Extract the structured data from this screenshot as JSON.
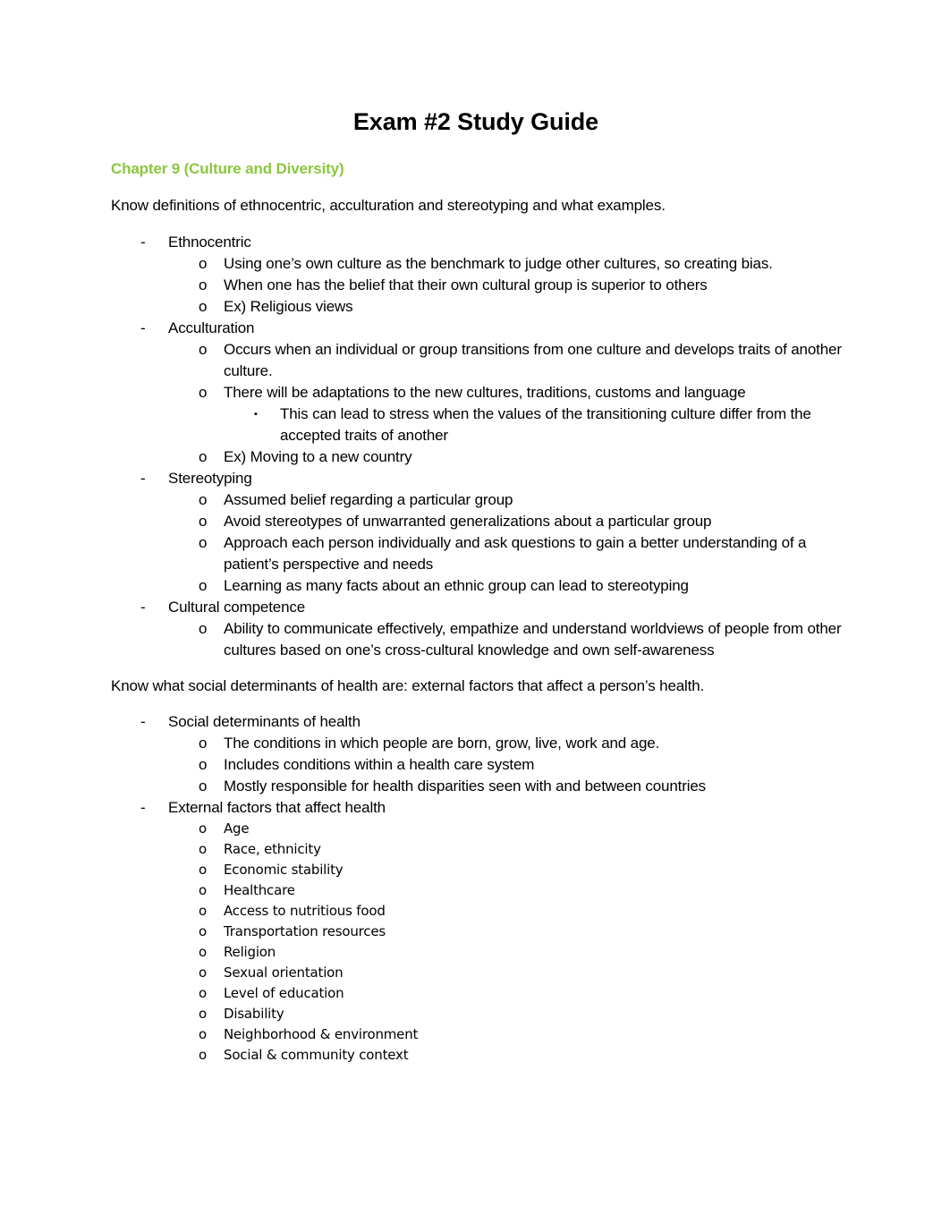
{
  "document": {
    "title": "Exam #2 Study Guide",
    "heading_color": "#8CC63E",
    "sections": [
      {
        "heading": "Chapter 9 (Culture and Diversity)",
        "blocks": [
          {
            "lead": "Know definitions of ethnocentric, acculturation and stereotyping and what examples.",
            "items": [
              {
                "level": 1,
                "marker": "-",
                "text": "Ethnocentric"
              },
              {
                "level": 2,
                "marker": "o",
                "text": "Using one’s own culture as the benchmark to judge other cultures, so creating bias."
              },
              {
                "level": 2,
                "marker": "o",
                "text": "When one has the belief that their own cultural group is superior to others"
              },
              {
                "level": 2,
                "marker": "o",
                "text": "Ex) Religious views"
              },
              {
                "level": 1,
                "marker": "-",
                "text": "Acculturation"
              },
              {
                "level": 2,
                "marker": "o",
                "text": "Occurs when an individual or group transitions from one culture and develops traits of another culture."
              },
              {
                "level": 2,
                "marker": "o",
                "text": "There will be adaptations to the new cultures, traditions, customs and language"
              },
              {
                "level": 3,
                "marker": "▪",
                "text": "This can lead to stress when the values of the transitioning culture differ from the accepted traits of another"
              },
              {
                "level": 2,
                "marker": "o",
                "text": "Ex) Moving to a new country"
              },
              {
                "level": 1,
                "marker": "-",
                "text": "Stereotyping"
              },
              {
                "level": 2,
                "marker": "o",
                "text": "Assumed belief regarding a particular group"
              },
              {
                "level": 2,
                "marker": "o",
                "text": "Avoid stereotypes of unwarranted generalizations about a particular group"
              },
              {
                "level": 2,
                "marker": "o",
                "text": "Approach each person individually and ask questions to gain a better understanding of a patient’s perspective and needs"
              },
              {
                "level": 2,
                "marker": "o",
                "text": "Learning as many facts about an ethnic group can lead to stereotyping"
              },
              {
                "level": 1,
                "marker": "-",
                "text": "Cultural competence"
              },
              {
                "level": 2,
                "marker": "o",
                "text": "Ability to communicate effectively, empathize and understand worldviews of people from other cultures based on one’s cross-cultural knowledge and own self-awareness"
              }
            ]
          },
          {
            "lead": "Know what social determinants of health are: external factors that affect a person’s health.",
            "items": [
              {
                "level": 1,
                "marker": "-",
                "text": "Social determinants of health"
              },
              {
                "level": 2,
                "marker": "o",
                "text": "The conditions in which people are born, grow, live, work and age."
              },
              {
                "level": 2,
                "marker": "o",
                "text": "Includes conditions within a health care system"
              },
              {
                "level": 2,
                "marker": "o",
                "text": "Mostly responsible for health disparities seen with and between countries"
              },
              {
                "level": 1,
                "marker": "-",
                "text": "External factors that affect health"
              },
              {
                "level": 2,
                "marker": "o",
                "text": "Age"
              },
              {
                "level": 2,
                "marker": "o",
                "text": "Race, ethnicity"
              },
              {
                "level": 2,
                "marker": "o",
                "text": "Economic stability"
              },
              {
                "level": 2,
                "marker": "o",
                "text": "Healthcare"
              },
              {
                "level": 2,
                "marker": "o",
                "text": "Access to nutritious food"
              },
              {
                "level": 2,
                "marker": "o",
                "text": "Transportation resources"
              },
              {
                "level": 2,
                "marker": "o",
                "text": "Religion"
              },
              {
                "level": 2,
                "marker": "o",
                "text": "Sexual orientation"
              },
              {
                "level": 2,
                "marker": "o",
                "text": "Level of education"
              },
              {
                "level": 2,
                "marker": "o",
                "text": "Disability"
              },
              {
                "level": 2,
                "marker": "o",
                "text": "Neighborhood &amp; environment"
              },
              {
                "level": 2,
                "marker": "o",
                "text": "Social &amp; community context"
              }
            ]
          }
        ]
      }
    ]
  }
}
